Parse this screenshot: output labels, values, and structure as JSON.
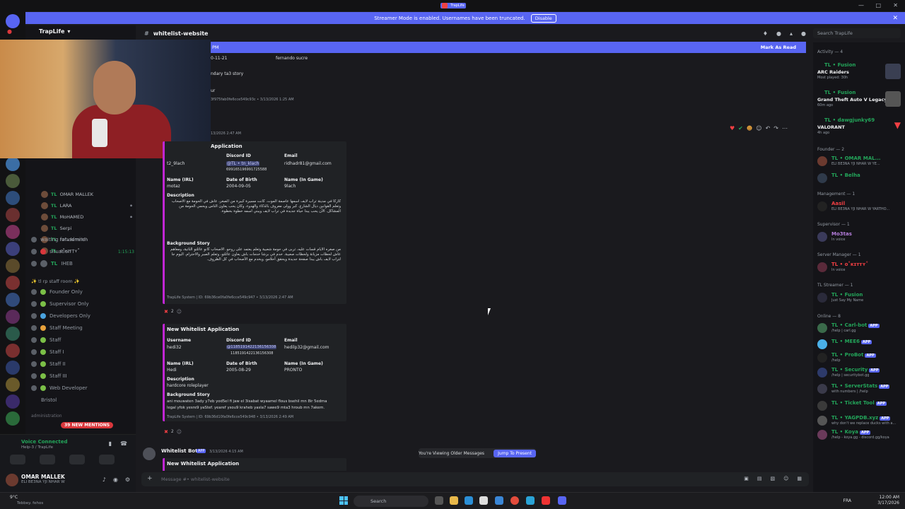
{
  "window": {
    "title": "TrapLife"
  },
  "banner": {
    "text": "Streamer Mode is enabled. Usernames have been truncated.",
    "button": "Disable"
  },
  "server": {
    "name": "TrapLife"
  },
  "channel": {
    "name": "whitelist-website"
  },
  "search": {
    "placeholder": "Search TrapLife"
  },
  "new_messages_bar": {
    "left": "PM",
    "right": "Mark As Read"
  },
  "voice_users": [
    {
      "name": "OMAR MALLEK",
      "tag": "TL"
    },
    {
      "name": "LARA",
      "tag": "TL"
    },
    {
      "name": "MoHAMED",
      "tag": "TL"
    },
    {
      "name": "Serpi",
      "tag": "TL"
    },
    {
      "name": "rafa lemridh",
      "tag": "TL"
    },
    {
      "name": "ᴏ˚ᴋɪᴛᴛʏ˚",
      "tag": "TL"
    }
  ],
  "channels_list": [
    {
      "name": "waiting for admin"
    },
    {
      "name": "situation l",
      "time": "1:15:13"
    },
    {
      "name": "IHEB",
      "tag": "TL"
    }
  ],
  "category": "✨ tl rp staff room ✨",
  "staff_channels": [
    "Founder Only",
    "Supervisor Only",
    "Developers Only",
    "Staff Meeting",
    "Staff",
    "Staff I",
    "Staff II",
    "Staff III",
    "Web Developer",
    "Bristol"
  ],
  "category2": "administration",
  "mentions_badge": "39 NEW MENTIONS",
  "voice": {
    "status": "Voice Connected",
    "sub": "Help-3 / TrapLife"
  },
  "user": {
    "name": "OMAR MALLEK",
    "status": "ELI BE3NA YJI NHAR W"
  },
  "messages": {
    "top_fragment": {
      "date": "0-11-21",
      "name": "fernando sucre",
      "line1": "ndary ta3 story",
      "line2": "ur",
      "footer": "3f975fab0fe6cce549c93c • 3/13/2026 1:25 AM"
    },
    "msg1": {
      "time": "13/2026 2:47 AM",
      "title": "Application",
      "username_label": "Username",
      "username": "t2_9lach",
      "discord_label": "Discord ID",
      "discord_mention": "@TL • tn_klach",
      "discord_id": "699165196991725588",
      "email_label": "Email",
      "email": "ridhadr81@gmail.com",
      "name_label": "Name (IRL)",
      "name": "motaz",
      "dob_label": "Date of Birth",
      "dob": "2004-09-05",
      "ingame_label": "Name (In Game)",
      "ingame": "9lach",
      "desc_label": "Description",
      "desc": "كاركا في مدينة تراب لايف اسمها عاصمة الموت. كانت مسيرة كبيرة من الصغر، عاش في الحومة مع الأصحاب وتعلم القوانين ديال الشارع. كبر وولى معروف بالذكاء والهدوء، وكان يحب يعاون الناس ويحمي الحومة من المشاكل. الآن يحب يبدا حياة جديدة في تراب لايف ويبني اسمه خطوة بخطوة.",
      "bg_label": "Background Story",
      "bg": "من صغره الأيام قسات عليه، تربى في حومة شعبية وتعلم يعتمد على روحو. الأصحاب كانو عائلتو الثانية، ومعاهم عاش لحظات مزيانة ولحظات صعيبة. خدم في برشا خدمات باش يعاون عائلتو، وتعلم الصبر والاحترام. اليوم جا لتراب لايف باش يبدا صفحة جديدة ويحقق أحلامو، ويخدم مع الأصحاب في كل الظروف.",
      "footer": "TrapLife System | ID: 69b36ce0fa0fe6cce549c947 • 3/13/2026 2:47 AM",
      "react_count": "2"
    },
    "msg2": {
      "title": "New Whitelist Application",
      "username_label": "Username",
      "username": "hedi32",
      "discord_label": "Discord ID",
      "discord_mention": "@1185191422136156308",
      "discord_id": "1185191422136156308",
      "email_label": "Email",
      "email": "hedilp32@gmail.com",
      "name_label": "Name (IRL)",
      "name": "Hedi",
      "dob_label": "Date of Birth",
      "dob": "2005-08-29",
      "ingame_label": "Name (In Game)",
      "ingame": "PRONTO",
      "desc_label": "Description",
      "desc": "hardcore roleplayer",
      "bg_label": "Background Story",
      "bg1": "ani mouwaten 3ady y7eb yod5el fi jaw el 3isabat wyaamel flous bsehil mn 8ir 5edma",
      "bg2": "legal yfok yesre9 yaStef. yearef ysou9 kraheb yasla7 sawe9 mta3 hroub mn 7akem.",
      "footer": "TrapLife System | ID: 69b36d10fa0fe6cce549c948 • 3/13/2026 2:49 AM",
      "react_count": "2"
    },
    "msg3": {
      "author": "Whitelist Bot",
      "badge": "APP",
      "time": "3/13/2026 4:15 AM",
      "title": "New Whitelist Application"
    }
  },
  "older_bar": {
    "text": "You're Viewing Older Messages",
    "button": "Jump To Present"
  },
  "composer": {
    "placeholder": "Message #• whitelist-website"
  },
  "members": {
    "activity_header": "Activity — 4",
    "activity": [
      {
        "name": "TL • Fusion",
        "game": "ARC Raiders",
        "sub": "Most played: 30h"
      },
      {
        "name": "TL • Fusion",
        "game": "Grand Theft Auto V Legacy",
        "sub": "60m ago"
      },
      {
        "name": "TL • dawgjunky69",
        "game": "VALORANT",
        "sub": "4h ago"
      }
    ],
    "founder_header": "Founder — 2",
    "founders": [
      {
        "name": "TL • OMAR MAL...",
        "sub": "ELI BE3NA YJI NHAR W YE..."
      },
      {
        "name": "TL • Belha",
        "sub": ""
      }
    ],
    "management_header": "Management — 1",
    "management": [
      {
        "name": "Aasil",
        "sub": "ELI BE3NA YJI NHAR W YARTHO..."
      }
    ],
    "supervisor_header": "Supervisor — 1",
    "supervisor": [
      {
        "name": "Mo3tas",
        "sub": "In voice"
      }
    ],
    "server_manager_header": "Server Manager — 1",
    "server_manager": [
      {
        "name": "TL • ᴏ˚ᴋɪᴛᴛʏ˚",
        "sub": "In voice"
      }
    ],
    "streamer_header": "TL Streamer — 1",
    "streamer": [
      {
        "name": "TL • Fusion",
        "sub": "Just Say My Name"
      }
    ],
    "online_header": "Online — 8",
    "online": [
      {
        "name": "TL • Carl-bot",
        "sub": "/help | carl.gg"
      },
      {
        "name": "TL • MEE6",
        "sub": ""
      },
      {
        "name": "TL • ProBot",
        "sub": "/help"
      },
      {
        "name": "TL • Security",
        "sub": "/help | securitybot.gg"
      },
      {
        "name": "TL • ServerStats",
        "sub": "with numbers | /help"
      },
      {
        "name": "TL • Ticket Tool",
        "sub": ""
      },
      {
        "name": "TL • YAGPDB.xyz",
        "sub": "why don't we replace ducks with a..."
      },
      {
        "name": "TL • Koya",
        "sub": "/help - koya.gg - discord.gg/koya"
      }
    ],
    "app_badge": "APP"
  },
  "taskbar": {
    "weather": "9°C",
    "weather_sub": "Tebbey. fehos",
    "search": "Search",
    "lang": "FRA",
    "time": "12:00 AM",
    "date": "3/17/2026"
  },
  "colors": {
    "brand": "#5865f2",
    "green": "#23a55a",
    "red": "#f23f43",
    "embed_bar": "#c026d3"
  }
}
